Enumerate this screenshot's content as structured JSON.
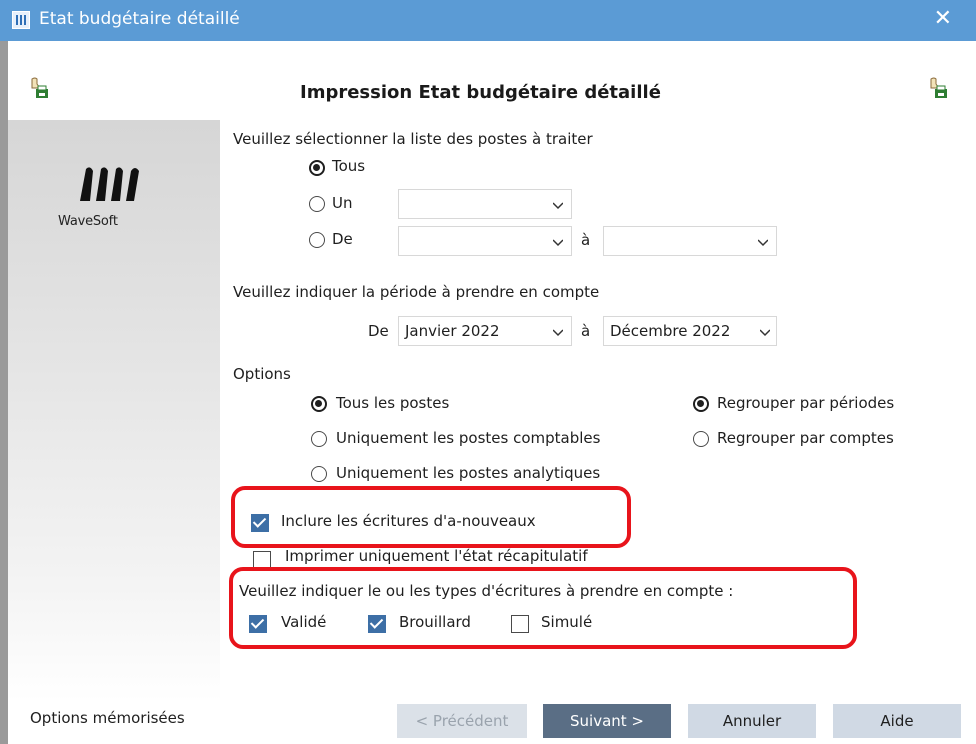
{
  "window": {
    "title": "Etat budgétaire détaillé",
    "close_glyph": "✕"
  },
  "brand": {
    "logo_text": "WaveSoft"
  },
  "header": {
    "title": "Impression Etat budgétaire détaillé",
    "left_icon": "print-config-icon",
    "right_icon": "print-config-icon"
  },
  "postes": {
    "prompt": "Veuillez sélectionner la liste des postes à traiter",
    "options": [
      {
        "label": "Tous",
        "checked": true
      },
      {
        "label": "Un",
        "checked": false
      },
      {
        "label": "De",
        "checked": false
      }
    ],
    "un_value": "",
    "de_from_value": "",
    "a_label": "à",
    "de_to_value": ""
  },
  "periode": {
    "prompt": "Veuillez indiquer la période à prendre en compte",
    "de_label": "De",
    "from_value": "Janvier 2022",
    "a_label": "à",
    "to_value": "Décembre 2022"
  },
  "options": {
    "title": "Options",
    "postes": [
      {
        "label": "Tous les postes",
        "checked": true
      },
      {
        "label": "Uniquement les postes comptables",
        "checked": false
      },
      {
        "label": "Uniquement les postes analytiques",
        "checked": false
      }
    ],
    "regroupement": [
      {
        "label": "Regrouper par périodes",
        "checked": true
      },
      {
        "label": "Regrouper par comptes",
        "checked": false
      }
    ],
    "inclure_a_nouveaux": {
      "label": "Inclure les écritures d'a-nouveaux",
      "checked": true
    },
    "recap_only": {
      "label": "Imprimer uniquement l'état récapitulatif",
      "checked": false
    }
  },
  "types": {
    "prompt": "Veuillez indiquer le ou les types d'écritures à prendre en compte :",
    "items": [
      {
        "label": "Validé",
        "checked": true
      },
      {
        "label": "Brouillard",
        "checked": true
      },
      {
        "label": "Simulé",
        "checked": false
      }
    ]
  },
  "footer": {
    "memorized_label": "Options mémorisées",
    "prev_label": "< Précédent",
    "next_label": "Suivant >",
    "cancel_label": "Annuler",
    "help_label": "Aide"
  },
  "colors": {
    "titlebar": "#5b9bd5",
    "highlight": "#e8141b",
    "checkbox": "#3d6fa6",
    "primary_button": "#5a6e85"
  }
}
